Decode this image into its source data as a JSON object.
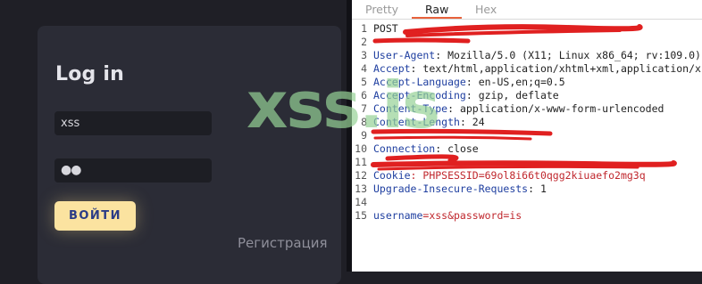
{
  "login": {
    "title": "Log in",
    "username_value": "xss",
    "password_value": "●●",
    "submit_label": "ВОЙТИ",
    "register_link": "Регистрация"
  },
  "viewer": {
    "tabs": [
      "Pretty",
      "Raw",
      "Hex"
    ],
    "active_tab": "Raw",
    "lines": [
      {
        "n": "1",
        "key": "POST ",
        "val": ""
      },
      {
        "n": "2",
        "key": "",
        "val": ""
      },
      {
        "n": "3",
        "key": "User-Agent",
        "val": ": Mozilla/5.0 (X11; Linux x86_64; rv:109.0)"
      },
      {
        "n": "4",
        "key": "Accept",
        "val": ": text/html,application/xhtml+xml,application/x"
      },
      {
        "n": "5",
        "key": "Accept-Language",
        "val": ": en-US,en;q=0.5"
      },
      {
        "n": "6",
        "key": "Accept-Encoding",
        "val": ": gzip, deflate"
      },
      {
        "n": "7",
        "key": "Content-Type",
        "val": ": application/x-www-form-urlencoded"
      },
      {
        "n": "8",
        "key": "Content-Length",
        "val": ": 24"
      },
      {
        "n": "9",
        "key": "",
        "val": ""
      },
      {
        "n": "10",
        "key": "Connection",
        "val": ": close"
      },
      {
        "n": "11",
        "key": "",
        "val": ""
      },
      {
        "n": "12",
        "key": "Cookie",
        "val": ": PHPSESSID=69ol8i66t0qgg2kiuaefo2mg3q"
      },
      {
        "n": "13",
        "key": "Upgrade-Insecure-Requests",
        "val": ": 1"
      },
      {
        "n": "14",
        "key": "",
        "val": ""
      },
      {
        "n": "15",
        "key": "username",
        "val": "=xss&password=is"
      }
    ]
  },
  "watermark": "xss.is",
  "colors": {
    "button": "#fbe3a0",
    "button_text": "#2a3b86",
    "tab_accent": "#e8623c",
    "redaction": "#e02020",
    "watermark": "#96d296"
  }
}
